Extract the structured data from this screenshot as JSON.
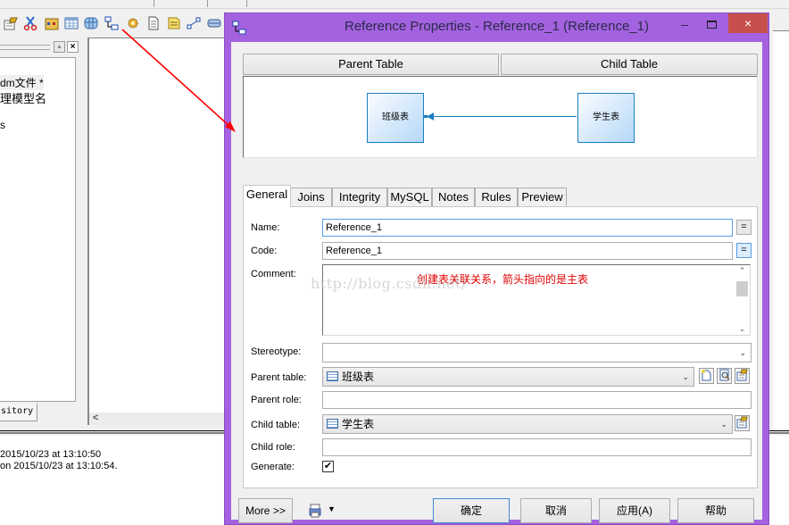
{
  "app": {
    "browser_tree": {
      "items": [
        {
          "label": "dm文件 *"
        },
        {
          "label": "理模型名"
        },
        {
          "label": "s"
        }
      ],
      "tab_label": "sitory"
    },
    "canvas": {
      "scroll_left_icon": "chevron-left-icon"
    },
    "output": {
      "lines": [
        "2015/10/23 at 13:10:50",
        "on 2015/10/23 at 13:10:54."
      ]
    },
    "toolbar": {
      "icons": [
        "properties-icon",
        "cut-icon",
        "package-icon",
        "table-icon",
        "view-icon",
        "reference-icon",
        "procedure-icon",
        "file-icon",
        "text-note-icon",
        "link-icon",
        "storage-icon"
      ]
    }
  },
  "dialog": {
    "title": "Reference Properties - Reference_1 (Reference_1)",
    "title_icon": "reference-icon",
    "window_controls": {
      "minimize": "–",
      "maximize": "□",
      "close": "×"
    },
    "colors": {
      "frame": "#a462e0",
      "close": "#c7504c",
      "entity_border": "#1a7fc0",
      "annotation": "#e00000"
    },
    "header_buttons": {
      "parent_table": "Parent Table",
      "child_table": "Child Table"
    },
    "diagram": {
      "parent_entity": "班级表",
      "child_entity": "学生表"
    },
    "tabs": [
      {
        "label": "General",
        "active": true
      },
      {
        "label": "Joins"
      },
      {
        "label": "Integrity"
      },
      {
        "label": "MySQL"
      },
      {
        "label": "Notes"
      },
      {
        "label": "Rules"
      },
      {
        "label": "Preview"
      }
    ],
    "general": {
      "name_label": "Name:",
      "name_value": "Reference_1",
      "code_label": "Code:",
      "code_value": "Reference_1",
      "eq_label": "=",
      "comment_label": "Comment:",
      "comment_value": "",
      "annotation_text": "创建表关联关系，箭头指向的是主表",
      "watermark": "http://blog.csdn.net/",
      "stereotype_label": "Stereotype:",
      "stereotype_value": "",
      "parent_table_label": "Parent table:",
      "parent_table_value": "班级表",
      "parent_role_label": "Parent role:",
      "parent_role_value": "",
      "child_table_label": "Child table:",
      "child_table_value": "学生表",
      "child_role_label": "Child role:",
      "child_role_value": "",
      "generate_label": "Generate:",
      "generate_checked": true,
      "check_mark": "✔"
    },
    "footer": {
      "more": "More >>",
      "ok": "确定",
      "cancel": "取消",
      "apply": "应用(A)",
      "help": "帮助"
    }
  }
}
